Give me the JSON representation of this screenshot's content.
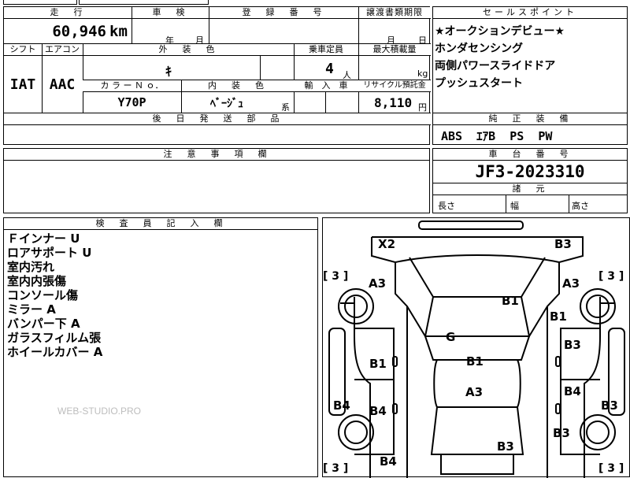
{
  "top": {
    "mileage_label": "走　行",
    "inspection_label": "車　検",
    "registration_label": "登　録　番　号",
    "transfer_deadline_label": "譲渡書類期限",
    "mileage": "60,946",
    "mileage_unit": "km",
    "inspection_year": "年",
    "inspection_month": "月",
    "transfer_month": "月",
    "transfer_day": "日"
  },
  "row2": {
    "shift_label": "シフト",
    "ac_label": "エアコン",
    "exterior_color_label": "外　装　色",
    "capacity_label": "乗車定員",
    "max_load_label": "最大積載量",
    "shift": "IAT",
    "ac": "AAC",
    "exterior_color": "ｷ",
    "capacity": "4",
    "capacity_unit": "人",
    "max_load_unit": "kg",
    "color_no_label": "カ ラ ー Ｎ ｏ．",
    "interior_color_label": "内　装　色",
    "import_label": "輸　入　車",
    "recycle_label": "リサイクル預託金",
    "color_no": "Y70P",
    "interior_color": "ﾍﾞｰｼﾞｭ",
    "interior_suffix": "系",
    "recycle_fee": "8,110",
    "recycle_unit": "円",
    "later_parts_label": "後　日　発　送　部　品"
  },
  "notes_section": {
    "label": "注　意　事　項　欄"
  },
  "sales": {
    "label": "セールスポイント",
    "items": [
      "★オークションデビュー★",
      "ホンダセンシング",
      "両側パワースライドドア",
      "プッシュスタート"
    ]
  },
  "equipment": {
    "label": "純　正　装　備",
    "value": "ABS  ｴｱB  PS  PW"
  },
  "chassis": {
    "label": "車　台　番　号",
    "value": "JF3-2023310"
  },
  "dimensions": {
    "label": "諸　元",
    "length_label": "長さ",
    "width_label": "幅",
    "height_label": "高さ"
  },
  "inspector": {
    "label": "検　査　員　記　入　欄",
    "notes": [
      "Ｆインナー U",
      "ロアサポート U",
      "室内汚れ",
      "室内内張傷",
      "コンソール傷",
      "ミラー A",
      "バンパー下 A",
      "ガラスフィルム張",
      "ホイールカバー A"
    ],
    "watermark": "WEB-STUDIO.PRO"
  },
  "diagram": {
    "labels": {
      "x2": "X2",
      "b3_top_right": "B3",
      "a3_left": "A3",
      "a3_right": "A3",
      "b1_roof": "B1",
      "b1_right": "B1",
      "g": "G",
      "b3_right_door": "B3",
      "b1_left_door": "B1",
      "b1_center": "B1",
      "a3_center": "A3",
      "b4_right_door": "B4",
      "b4_left": "B4",
      "b4_left_door": "B4",
      "b3_far_right": "B3",
      "b3_right_lower": "B3",
      "b3_bottom": "B3",
      "b4_bottom": "B4",
      "bracket_tl": "[ 3 ]",
      "bracket_tr": "[ 3 ]",
      "bracket_bl": "[ 3 ]",
      "bracket_br": "[ 3 ]"
    }
  }
}
